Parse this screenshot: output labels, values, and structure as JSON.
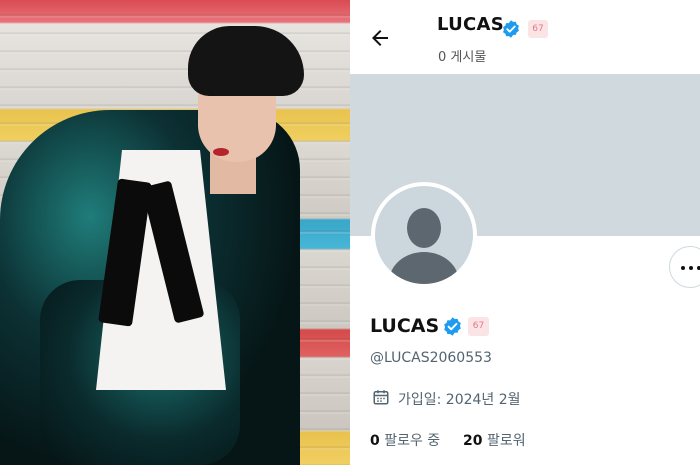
{
  "header": {
    "display_name": "LUCAS",
    "badge": "67",
    "posts_count": "0",
    "posts_label": "게시물"
  },
  "profile": {
    "display_name": "LUCAS",
    "badge": "67",
    "handle": "@LUCAS2060553",
    "joined": "가입일: 2024년 2월",
    "following_count": "0",
    "following_label": "팔로우 중",
    "followers_count": "20",
    "followers_label": "팔로워"
  },
  "colors": {
    "verified": "#1d9bf0",
    "banner": "#cfd9de",
    "secondary_text": "#536471"
  },
  "icons": [
    "back-arrow-icon",
    "verified-icon",
    "calendar-icon",
    "more-icon",
    "default-avatar-icon"
  ]
}
